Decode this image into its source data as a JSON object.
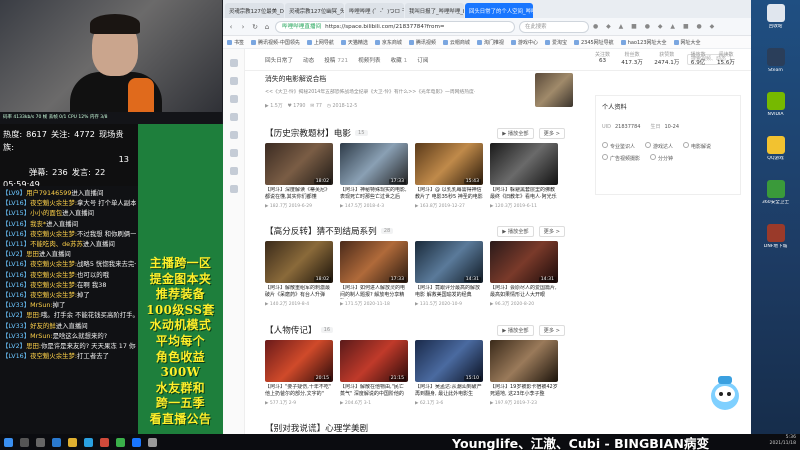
{
  "stream": {
    "webcam_bar": "码率 4133kb/s 70 帧 丢帧 0/1   CPU 12% 内存 3/8",
    "stats": {
      "hot_label": "热度:",
      "hot": "8617",
      "follow_label": "关注:",
      "follow": "4772",
      "fans_label": "现场贵族:",
      "fans": "13",
      "danmu_label": "弹幕:",
      "danmu": "236",
      "gift_label": "发言:",
      "gift": "22",
      "timer": "05:59:49"
    },
    "chat": [
      {
        "lv": "【LV9】",
        "name": "用户79146599",
        "text": "进入直播间"
      },
      {
        "lv": "【LV16】",
        "name": "夜空魈火余生梦:",
        "text": "拿大号 打个单人副本去 有敏号继续刷材料"
      },
      {
        "lv": "【LV15】",
        "name": "小小的面包",
        "text": "进入直播间"
      },
      {
        "lv": "【LV16】",
        "name": "我丧*",
        "text": "进入直播间"
      },
      {
        "lv": "【LV16】",
        "name": "夜空魈火余生梦:",
        "text": "不过我想 和你刷俩一样难可以"
      },
      {
        "lv": "【LV11】",
        "name": "不能吃肉、de苏苏",
        "text": "进入直播间"
      },
      {
        "lv": "【LV2】",
        "name": "思田",
        "text": "进入直播间"
      },
      {
        "lv": "【LV16】",
        "name": "夜空魈火余生梦:",
        "text": "战略5 恍惚我来去完一元 军神"
      },
      {
        "lv": "【LV16】",
        "name": "夜空魈火余生梦:",
        "text": "也可以的哦"
      },
      {
        "lv": "【LV16】",
        "name": "夜空魈火余生梦:",
        "text": "在啊 我38"
      },
      {
        "lv": "【LV16】",
        "name": "夜空魈火余生梦:",
        "text": "掉了"
      },
      {
        "lv": "【LV33】",
        "name": "MrSun:",
        "text": "掉了"
      },
      {
        "lv": "【LV2】",
        "name": "思田:",
        "text": "哦。打手余 不能花钱买高阶打手。不然很容易亏啊"
      },
      {
        "lv": "【LV33】",
        "name": "好友的鲜",
        "text": "进入直播间"
      },
      {
        "lv": "【LV33】",
        "name": "MrSun:",
        "text": "是啥这么就想来的?"
      },
      {
        "lv": "【LV2】",
        "name": "思田:",
        "text": "你是许是来友的? 天天果冻 17 你都些就彩票钱吗?你你?"
      },
      {
        "lv": "【LV16】",
        "name": "夜空魈火余生梦:",
        "text": "打工者去了"
      }
    ],
    "promo_lines": [
      "主播跨一区",
      "提金图本夹",
      "推荐装备",
      "100级SS套",
      "水动机模式",
      "平均每个",
      "角色收益",
      "300W",
      "水友群和",
      "跨一五季",
      "看直播公告"
    ],
    "ticker": "Younglife、江澈、Cubi - BINGBIAN病变"
  },
  "browser": {
    "tabs": [
      {
        "label": "灵魂宗教127位最美_DW·",
        "active": false
      },
      {
        "label": "灵魂宗教127位幽冥_头条",
        "active": false
      },
      {
        "label": "哔哩哔哩 (゜-゜)つロ 干杯",
        "active": false
      },
      {
        "label": "我叫日报了_哔哩哔哩_bili",
        "active": false
      },
      {
        "label": "回头日常了的个人空间_哔哩哔哩",
        "active": true
      }
    ],
    "url_safe": "哔哩哔哩直播间",
    "url": "https://space.bilibili.com/21837784?from=",
    "search_placeholder": "在此搜索",
    "bookmarks": [
      "书签",
      "腾讯视频-中国领先",
      "上网导航",
      "天猫精选",
      "京东商城",
      "腾讯视频",
      "云帽商城",
      "淘门推视",
      "游戏中心",
      "爱淘宝",
      "2345网址导航",
      "hao123网址大全",
      "网址大全"
    ],
    "profile_nav": [
      {
        "label": "回头日常了",
        "count": ""
      },
      {
        "label": "动态",
        "count": ""
      },
      {
        "label": "投稿",
        "count": "721"
      },
      {
        "label": "视频列表",
        "count": ""
      },
      {
        "label": "收藏",
        "count": "1"
      },
      {
        "label": "订阅",
        "count": ""
      }
    ],
    "profile_search": "搜索视频、动态",
    "profile_stats": [
      {
        "k": "关注数",
        "v": "63"
      },
      {
        "k": "粉丝数",
        "v": "417.3万"
      },
      {
        "k": "获赞数",
        "v": "2474.1万"
      },
      {
        "k": "播放数",
        "v": "6.9亿"
      },
      {
        "k": "阅读数",
        "v": "15.6万"
      }
    ],
    "top_item": {
      "title": "消失的电影解说合档",
      "desc": "<<《大卫·怜》揭秘2014年五部恐怖战场全纪录《大卫·怜》有什么>>《光年电影》一周网络热度·",
      "views": "1.5万",
      "likes": "1790",
      "comments": "77",
      "date": "2018-12-5"
    },
    "sections": [
      {
        "title": "【历史宗教题材】电影",
        "count": "15",
        "playall": "▶ 播放全部",
        "more": "更多 >",
        "videos": [
          {
            "dur": "18:02",
            "title": "【阿斗】深度解读《蒂芙尼》都说在懂,其实你们都懂",
            "meta": "▶ 182.7万  2019-6-29",
            "bg": "linear-gradient(135deg,#3b2b22,#7a5d45,#1f1a16)"
          },
          {
            "dur": "17:33",
            "title": "【阿斗】神秘特殊现实的电影,表现死亡时那些亡过世之后",
            "meta": "▶ 147.5万  2018-4-3",
            "bg": "linear-gradient(135deg,#2e3b48,#8aa0b4,#222)"
          },
          {
            "dur": "15:43",
            "title": "【阿斗】@ 以乳乳每需得神信教片了 电影35秒5 神圣的电影",
            "meta": "▶ 163.8万  2019-12-27",
            "bg": "linear-gradient(135deg,#5a3a1a,#c08a4a,#2a1a0a)"
          },
          {
            "dur": "",
            "title": "【阿斗】躲避黑套层里的佛教最终《旧教年》看电人·阿光乐",
            "meta": "▶ 120.3万  2019-6-11",
            "bg": "linear-gradient(135deg,#1a1a1a,#6a6a6a,#111)"
          }
        ]
      },
      {
        "title": "【高分反转】猜不到结局系列",
        "count": "28",
        "playall": "▶ 播放全部",
        "more": "更多 >",
        "videos": [
          {
            "dur": "18:02",
            "title": "【阿斗】解散重组军的刺激最破片《呆磨药》有台人升弹",
            "meta": "▶ 140.2万  2019-8-4",
            "bg": "linear-gradient(135deg,#3a2a1a,#8a6a3a,#1a120a)"
          },
          {
            "dur": "17:33",
            "title": "【阿斗】如何进人解放灵的电间的制人题报? 解放电分享精致电",
            "meta": "▶ 171.5万  2020-11-18",
            "bg": "linear-gradient(135deg,#4a2a1a,#b06a3a,#2a1a10)"
          },
          {
            "dur": "14:31",
            "title": "【阿斗】竟跟评分最高的解放电影 解救美国瑜发的经典",
            "meta": "▶ 131.5万  2020-10-9",
            "bg": "linear-gradient(135deg,#1a2a3a,#5a7a9a,#101a24)"
          },
          {
            "dur": "14:31",
            "title": "【阿斗】会原尽人的爱国篇片,最高如果情形让人大开眼",
            "meta": "▶ 96.3万  2020-8-20",
            "bg": "linear-gradient(135deg,#2a1a1a,#7a3a2a,#1a0a0a)"
          }
        ]
      },
      {
        "title": "【人物传记】",
        "count": "16",
        "playall": "▶ 播放全部",
        "more": "更多 >",
        "videos": [
          {
            "dur": "20:15",
            "title": "【阿斗】\"要子疑伤,十年不吃\" 他上扔爸尔的部分,文字的\"",
            "meta": "▶ 577.1万  2-9",
            "bg": "linear-gradient(135deg,#6a1a1a,#d04a2a,#2a0a0a)"
          },
          {
            "dur": "21:15",
            "title": "【阿斗】解散在他物由,\"民亡蒸气\" 深度解说的中国阶他的",
            "meta": "▶ 204.6万  3-1",
            "bg": "linear-gradient(135deg,#5a1a1a,#c03a2a,#2a0a0a)"
          },
          {
            "dur": "15:10",
            "title": "【阿斗】吴孟达:从潮汕到破产再到翻身, 最让此外电影生",
            "meta": "▶ 62.1万  3-6",
            "bg": "linear-gradient(135deg,#1a2a4a,#4a6aa0,#0a1020)"
          },
          {
            "dur": "",
            "title": "【阿斗】19岁被影卡宿被42岁死遁地, 这23年小李子整",
            "meta": "▶ 197.9万  2019-7-23",
            "bg": "linear-gradient(135deg,#3a2a1a,#9a7a5a,#1a120a)"
          }
        ]
      },
      {
        "title": "【别对我说谎】心理学美剧",
        "count": "",
        "playall": "",
        "more": "",
        "videos": []
      }
    ],
    "info": {
      "title": "个人资料",
      "uid_label": "UID",
      "uid": "21837784",
      "bday_label": "生日",
      "bday": "10-24",
      "tags": [
        "专业鉴识人",
        "游戏达人",
        "电影解说",
        "广告视频摄影",
        "分分钟"
      ]
    }
  },
  "desktop": [
    {
      "label": "回收站",
      "color": "#e0e6ee"
    },
    {
      "label": "Steam",
      "color": "#2a3e5a"
    },
    {
      "label": "NVIDIA",
      "color": "#76b900"
    },
    {
      "label": "QQ游戏",
      "color": "#f2c230"
    },
    {
      "label": "360安全卫士",
      "color": "#3a9a3a"
    },
    {
      "label": "DNF地下城",
      "color": "#9a3a2a"
    }
  ],
  "clock": {
    "time": "5:36",
    "date": "2021/11/18"
  }
}
